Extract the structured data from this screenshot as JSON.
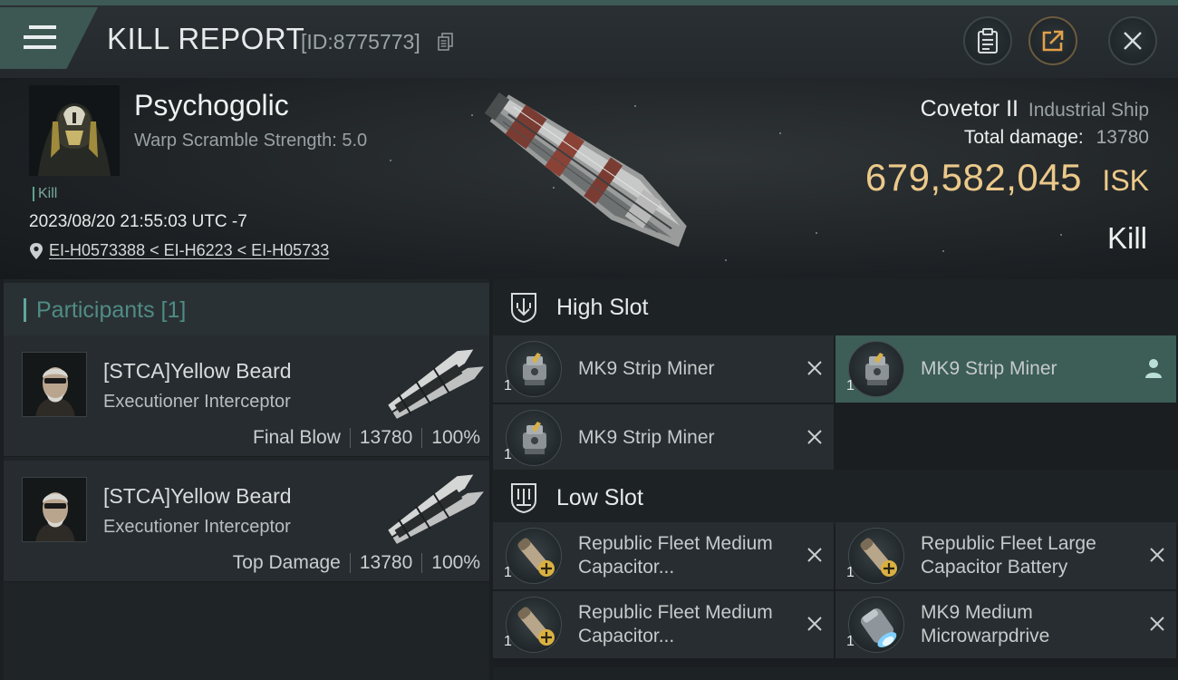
{
  "header": {
    "title": "KILL REPORT",
    "report_id": "[ID:8775773]"
  },
  "victim": {
    "name": "Psychogolic",
    "warp_scramble": "Warp Scramble Strength: 5.0",
    "kill_tag": "Kill",
    "date": "2023/08/20 21:55:03 UTC -7",
    "location": "EI-H0573388 < EI-H6223 < EI-H05733",
    "ship_name": "Covetor II",
    "ship_class": "Industrial Ship",
    "total_damage_label": "Total damage:",
    "total_damage": "13780",
    "isk_value": "679,582,045",
    "isk_unit": "ISK",
    "status": "Kill"
  },
  "participants": {
    "title": "Participants [1]",
    "items": [
      {
        "name": "[STCA]Yellow Beard",
        "ship": "Executioner Interceptor",
        "role": "Final Blow",
        "damage": "13780",
        "percent": "100%"
      },
      {
        "name": "[STCA]Yellow Beard",
        "ship": "Executioner Interceptor",
        "role": "Top Damage",
        "damage": "13780",
        "percent": "100%"
      }
    ]
  },
  "slots": {
    "high": {
      "title": "High Slot",
      "modules": [
        {
          "qty": "1",
          "name": "MK9 Strip Miner",
          "icon": "strip-miner-icon",
          "active": false
        },
        {
          "qty": "1",
          "name": "MK9 Strip Miner",
          "icon": "strip-miner-icon",
          "active": true
        },
        {
          "qty": "1",
          "name": "MK9 Strip Miner",
          "icon": "strip-miner-icon",
          "active": false
        }
      ]
    },
    "low": {
      "title": "Low Slot",
      "modules": [
        {
          "qty": "1",
          "name": "Republic Fleet Medium Capacitor...",
          "icon": "capacitor-battery-icon"
        },
        {
          "qty": "1",
          "name": "Republic Fleet Large Capacitor Battery",
          "icon": "capacitor-battery-icon"
        },
        {
          "qty": "1",
          "name": "Republic Fleet Medium Capacitor...",
          "icon": "capacitor-battery-icon"
        },
        {
          "qty": "1",
          "name": "MK9 Medium Microwarpdrive",
          "icon": "microwarpdrive-icon"
        }
      ]
    }
  },
  "colors": {
    "accent": "#3d5d57",
    "isk": "#ecc98a",
    "participants_title": "#4f8c85"
  }
}
